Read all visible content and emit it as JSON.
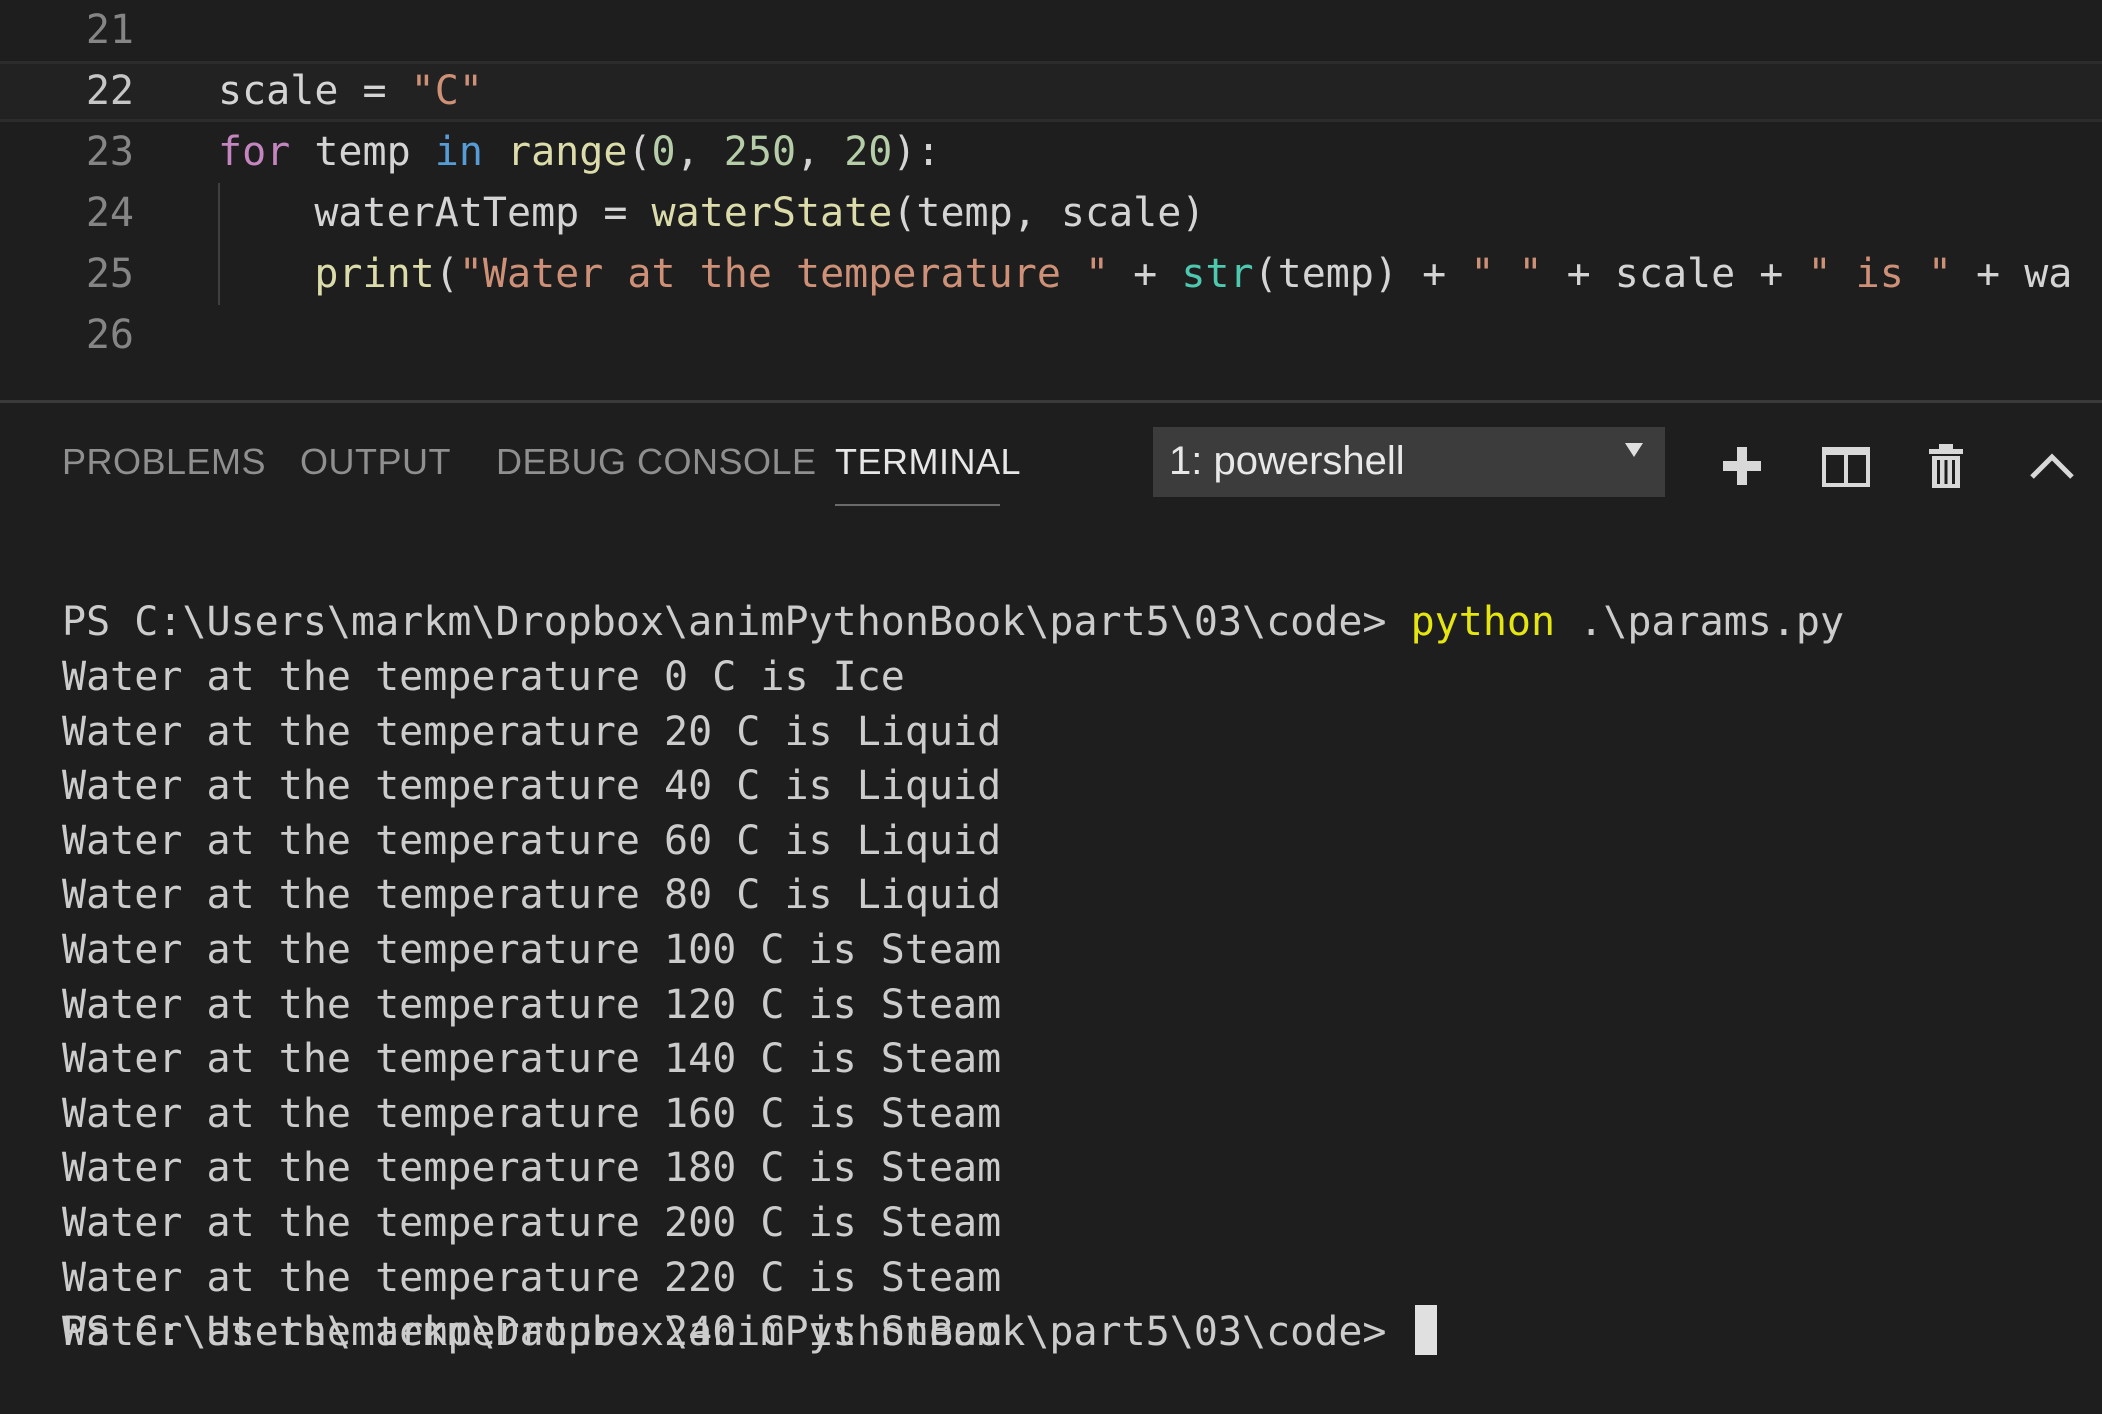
{
  "editor": {
    "lines": [
      {
        "number": "21",
        "tokens": []
      },
      {
        "number": "22",
        "current": true,
        "tokens": [
          {
            "t": "var",
            "v": "scale = "
          },
          {
            "t": "str",
            "v": "\"C\""
          }
        ]
      },
      {
        "number": "23",
        "tokens": [
          {
            "t": "kw-ctrl",
            "v": "for"
          },
          {
            "t": "var",
            "v": " temp "
          },
          {
            "t": "kw",
            "v": "in"
          },
          {
            "t": "var",
            "v": " "
          },
          {
            "t": "fn",
            "v": "range"
          },
          {
            "t": "var",
            "v": "("
          },
          {
            "t": "num",
            "v": "0"
          },
          {
            "t": "var",
            "v": ", "
          },
          {
            "t": "num",
            "v": "250"
          },
          {
            "t": "var",
            "v": ", "
          },
          {
            "t": "num",
            "v": "20"
          },
          {
            "t": "var",
            "v": "):"
          }
        ]
      },
      {
        "number": "24",
        "tokens": [
          {
            "t": "var",
            "v": "    waterAtTemp = "
          },
          {
            "t": "fn",
            "v": "waterState"
          },
          {
            "t": "var",
            "v": "(temp, scale)"
          }
        ]
      },
      {
        "number": "25",
        "tokens": [
          {
            "t": "var",
            "v": "    "
          },
          {
            "t": "fn",
            "v": "print"
          },
          {
            "t": "var",
            "v": "("
          },
          {
            "t": "str",
            "v": "\"Water at the temperature \""
          },
          {
            "t": "var",
            "v": " + "
          },
          {
            "t": "builtin",
            "v": "str"
          },
          {
            "t": "var",
            "v": "(temp) + "
          },
          {
            "t": "str",
            "v": "\" \""
          },
          {
            "t": "var",
            "v": " + scale + "
          },
          {
            "t": "str",
            "v": "\" is \""
          },
          {
            "t": "var",
            "v": " + wa"
          }
        ]
      },
      {
        "number": "26",
        "tokens": []
      }
    ]
  },
  "panel": {
    "tabs": [
      "PROBLEMS",
      "OUTPUT",
      "DEBUG CONSOLE",
      "TERMINAL"
    ],
    "active_tab": "TERMINAL",
    "terminal_selector": "1: powershell",
    "actions": [
      "plus-icon",
      "split-icon",
      "trash-icon",
      "chevron-up-icon"
    ]
  },
  "terminal": {
    "prompt": "PS C:\\Users\\markm\\Dropbox\\animPythonBook\\part5\\03\\code> ",
    "command": "python",
    "command_args": " .\\params.py",
    "output": [
      "Water at the temperature 0 C is Ice",
      "Water at the temperature 20 C is Liquid",
      "Water at the temperature 40 C is Liquid",
      "Water at the temperature 60 C is Liquid",
      "Water at the temperature 80 C is Liquid",
      "Water at the temperature 100 C is Steam",
      "Water at the temperature 120 C is Steam",
      "Water at the temperature 140 C is Steam",
      "Water at the temperature 160 C is Steam",
      "Water at the temperature 180 C is Steam",
      "Water at the temperature 200 C is Steam",
      "Water at the temperature 220 C is Steam",
      "Water at the temperature 240 C is Steam"
    ],
    "final_prompt": "PS C:\\Users\\markm\\Dropbox\\animPythonBook\\part5\\03\\code> "
  },
  "colors": {
    "background": "#1e1e1e",
    "keyword_control": "#c586c0",
    "keyword": "#569cd6",
    "function": "#dcdcaa",
    "number": "#b5cea8",
    "string": "#ce9178",
    "builtin": "#4ec9b0",
    "terminal_command": "#e5e510"
  }
}
